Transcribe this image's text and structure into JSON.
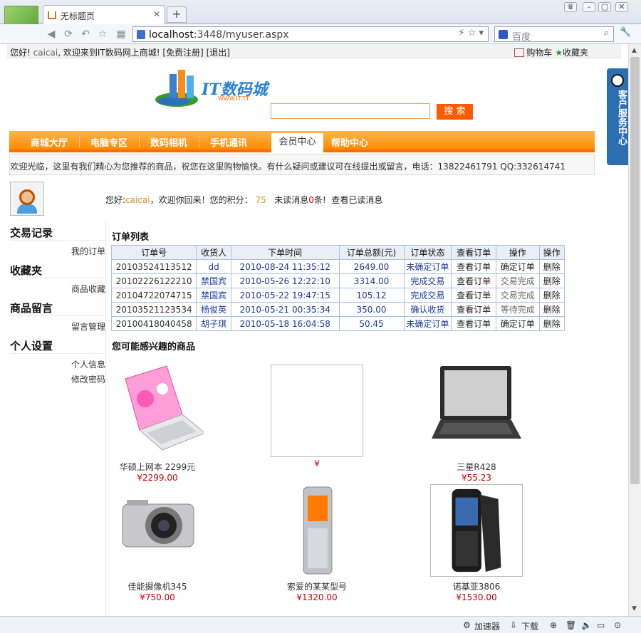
{
  "browser": {
    "tab_title": "无标题页",
    "new_tab": "+",
    "url_host": "localhost",
    "url_rest": ":3448/myuser.aspx",
    "search_placeholder": "百度",
    "status_accel": "加速器",
    "status_download": "下载"
  },
  "topbar": {
    "greeting_prefix": "您好!",
    "username": "caicai",
    "greeting_suffix": ", 欢迎来到IT数码网上商城!",
    "register": "[免费注册]",
    "logout": "[退出]",
    "cart": "购物车",
    "favorites": "收藏夹"
  },
  "site": {
    "logo_text": "IT数码城",
    "logo_sub": "WWW.IT.TT",
    "search_button": "搜 索",
    "nav": [
      "商城大厅",
      "电脑专区",
      "数码相机",
      "手机通讯",
      "会员中心",
      "帮助中心"
    ],
    "welcome": "欢迎光临，这里有我们精心为您推荐的商品，祝您在这里购物愉快。有什么疑问或建议可在线提出或留言，电话：13822461791 QQ:332614741",
    "kefu": "客户服务中心"
  },
  "user": {
    "hello": "您好:",
    "name": "caicai",
    "back": "，欢迎你回来！您的积分：",
    "points": "75",
    "unread_label": "未读消息",
    "unread": "0",
    "unread_suffix": "条!",
    "read_link": "查看已读消息"
  },
  "sidebar": [
    {
      "title": "交易记录",
      "links": [
        "我的订单"
      ]
    },
    {
      "title": "收藏夹",
      "links": [
        "商品收藏"
      ]
    },
    {
      "title": "商品留言",
      "links": [
        "留言管理"
      ]
    },
    {
      "title": "个人设置",
      "links": [
        "个人信息",
        "修改密码"
      ]
    }
  ],
  "orders": {
    "title": "订单列表",
    "headers": [
      "订单号",
      "收货人",
      "下单时间",
      "订单总额(元)",
      "订单状态",
      "查看订单",
      "操作",
      "操作"
    ],
    "rows": [
      [
        "20103524113512",
        "dd",
        "2010-08-24 11:35:12",
        "2649.00",
        "未确定订单",
        "查看订单",
        "确定订单",
        "删除"
      ],
      [
        "20102226122210",
        "禁国宾",
        "2010-05-26 12:22:10",
        "3314.00",
        "完成交易",
        "查看订单",
        "交易完成",
        "删除"
      ],
      [
        "20104722074715",
        "禁国宾",
        "2010-05-22 19:47:15",
        "105.12",
        "完成交易",
        "查看订单",
        "交易完成",
        "删除"
      ],
      [
        "20103521123534",
        "杨俊英",
        "2010-05-21 00:35:34",
        "350.00",
        "确认收货",
        "查看订单",
        "等待完成",
        "删除"
      ],
      [
        "20100418040458",
        "胡子琪",
        "2010-05-18 16:04:58",
        "50.45",
        "未确定订单",
        "查看订单",
        "确定订单",
        "删除"
      ]
    ]
  },
  "interest": {
    "title": "您可能感兴趣的商品",
    "products": [
      {
        "name": "华硕上网本 2299元",
        "price": "¥2299.00"
      },
      {
        "name": "",
        "price": "¥"
      },
      {
        "name": "三星R428",
        "price": "¥55.23"
      },
      {
        "name": "佳能摄像机345",
        "price": "¥750.00"
      },
      {
        "name": "索爱的某某型号",
        "price": "¥1320.00"
      },
      {
        "name": "诺基亚3806",
        "price": "¥1530.00"
      }
    ]
  }
}
